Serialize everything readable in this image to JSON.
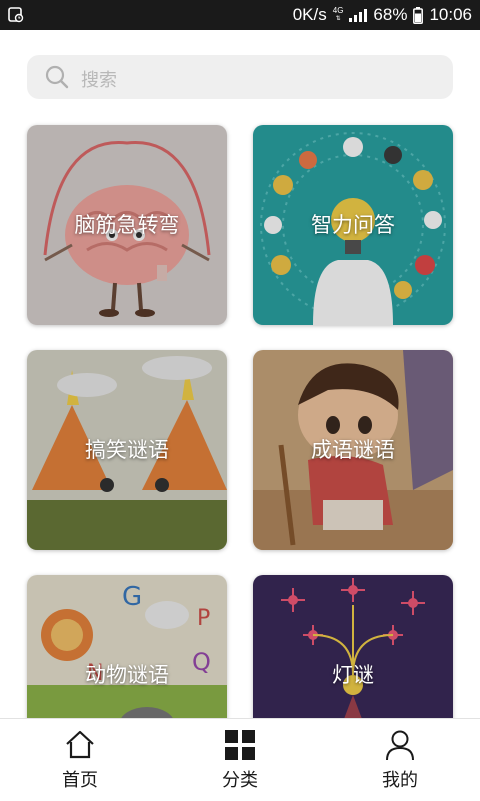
{
  "status_bar": {
    "speed": "0K/s",
    "network_type": "4G",
    "battery": "68%",
    "time": "10:06",
    "icons": [
      "notification-icon",
      "signal-icon",
      "battery-icon"
    ]
  },
  "search": {
    "placeholder": "搜索",
    "icon": "search-icon"
  },
  "categories": [
    {
      "label": "脑筋急转弯",
      "image": "brain-jump-rope"
    },
    {
      "label": "智力问答",
      "image": "lightbulb-head"
    },
    {
      "label": "搞笑谜语",
      "image": "volcano-cartoon"
    },
    {
      "label": "成语谜语",
      "image": "boy-with-stick"
    },
    {
      "label": "动物谜语",
      "image": "animal-letters"
    },
    {
      "label": "灯谜",
      "image": "fireworks-lantern"
    }
  ],
  "tabbar": {
    "items": [
      {
        "label": "首页",
        "icon": "home-icon"
      },
      {
        "label": "分类",
        "icon": "grid-icon"
      },
      {
        "label": "我的",
        "icon": "user-icon"
      }
    ]
  },
  "colors": {
    "status_bar_bg": "#1a1a1a",
    "search_bg": "#efefef",
    "placeholder": "#b8b8b8",
    "tab_text": "#1a1a1a"
  }
}
